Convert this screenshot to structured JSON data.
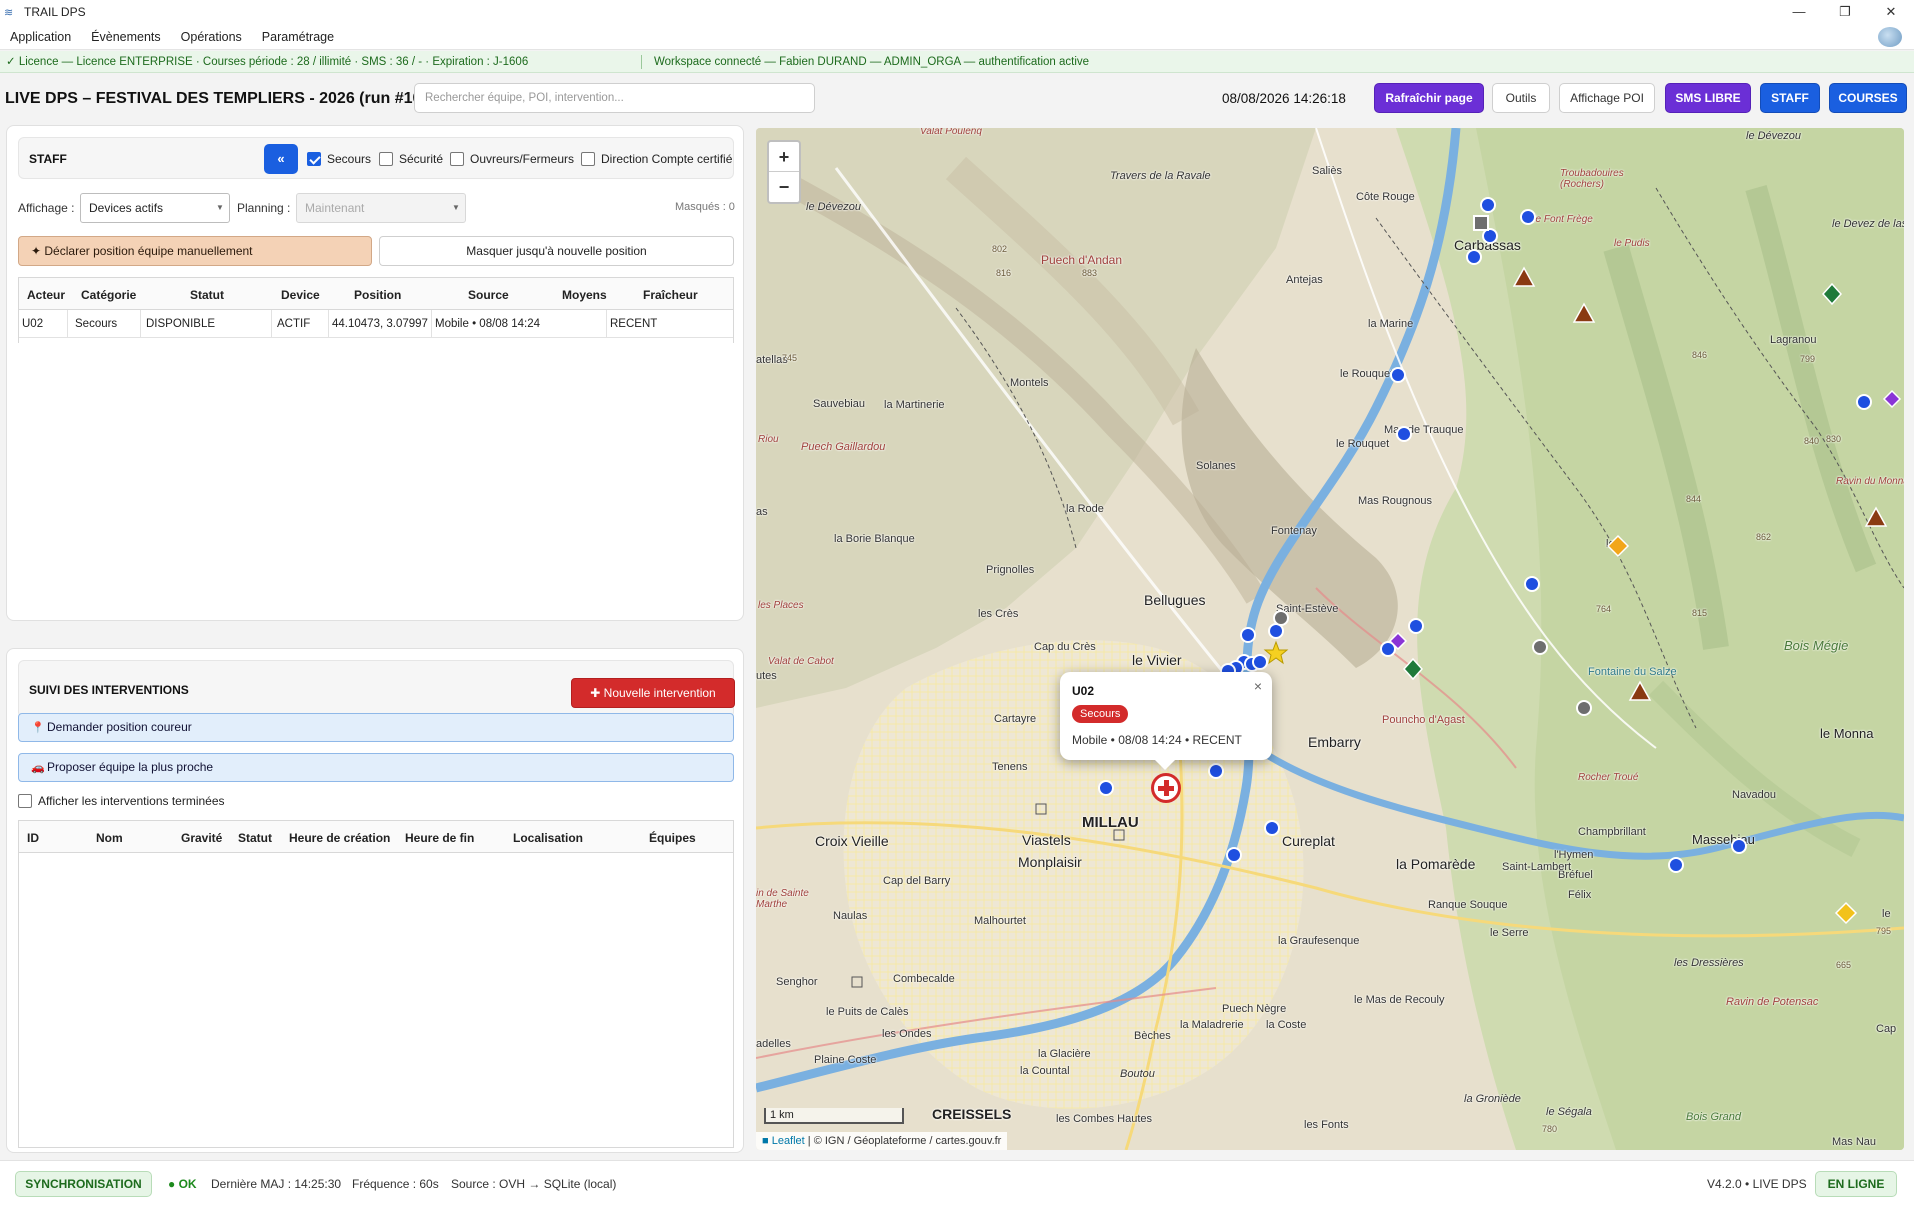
{
  "window": {
    "title": "TRAIL DPS",
    "minimize": "—",
    "maximize": "❐",
    "close": "✕"
  },
  "menu": {
    "items": [
      "Application",
      "Évènements",
      "Opérations",
      "Paramétrage"
    ]
  },
  "licence": {
    "left": "✓ Licence — Licence ENTERPRISE · Courses période : 28 / illimité · SMS : 36 / - · Expiration : J-1606",
    "right": "Workspace connecté — Fabien DURAND — ADMIN_ORGA — authentification active"
  },
  "header": {
    "title": "LIVE DPS – FESTIVAL DES TEMPLIERS - 2026 (run #10)",
    "search_placeholder": "Rechercher équipe, POI, intervention...",
    "datetime": "08/08/2026  14:26:18",
    "buttons": {
      "refresh": "Rafraîchir page",
      "tools": "Outils",
      "poi": "Affichage POI",
      "sms": "SMS LIBRE",
      "staff": "STAFF",
      "courses": "COURSES"
    }
  },
  "staff": {
    "title": "STAFF",
    "collapse": "«",
    "filters": [
      {
        "label": "Secours",
        "checked": true
      },
      {
        "label": "Sécurité",
        "checked": false
      },
      {
        "label": "Ouvreurs/Fermeurs",
        "checked": false
      },
      {
        "label": "Direction Compte certifié",
        "checked": false
      }
    ],
    "affichage_label": "Affichage :",
    "affichage_value": "Devices actifs",
    "planning_label": "Planning :",
    "planning_value": "Maintenant",
    "masked": "Masqués : 0",
    "declare_btn": "Déclarer position équipe manuellement",
    "hide_btn": "Masquer jusqu'à nouvelle position",
    "columns": [
      "Acteur",
      "Catégorie",
      "Statut",
      "Device",
      "Position",
      "Source",
      "Moyens",
      "Fraîcheur"
    ],
    "rows": [
      {
        "acteur": "U02",
        "categorie": "Secours",
        "statut": "DISPONIBLE",
        "device": "ACTIF",
        "position": "44.10473, 3.07997",
        "source": "Mobile • 08/08 14:24",
        "moyens": "",
        "fraicheur": "RECENT"
      }
    ]
  },
  "interventions": {
    "title": "SUIVI DES INTERVENTIONS",
    "new_btn": "Nouvelle intervention",
    "request_btn": "Demander position coureur",
    "propose_btn": "Proposer équipe la plus proche",
    "show_done": "Afficher les interventions terminées",
    "columns": [
      "ID",
      "Nom",
      "Gravité",
      "Statut",
      "Heure de création",
      "Heure de fin",
      "Localisation",
      "Équipes"
    ]
  },
  "map": {
    "zoom_in": "+",
    "zoom_out": "−",
    "scale": "1 km",
    "attribution_leaflet": "Leaflet",
    "attribution_rest": " | © IGN / Géoplateforme / cartes.gouv.fr",
    "popup": {
      "title": "U02",
      "badge": "Secours",
      "line": "Mobile • 08/08 14:24 • RECENT",
      "close": "×"
    },
    "places": {
      "millau": "MILLAU",
      "creissels": "CREISSELS",
      "bellugues": "Bellugues",
      "embarry": "Embarry",
      "cureplat": "Cureplat",
      "la_pomarede": "la Pomarède",
      "croix_vieille": "Croix Vieille",
      "viastels": "Viastels",
      "monplaisir": "Monplaisir",
      "le_vivier": "le Vivier",
      "carbassas": "Carbassas",
      "montels": "Montels",
      "solanes": "Solanes",
      "fontenay": "Fontenay",
      "la_rode": "la Rode",
      "prignolles": "Prignolles",
      "les_cres": "les Crès",
      "cap_du_cres": "Cap du Crès",
      "cartayre": "Cartayre",
      "tenens": "Tenens",
      "cap_del_barry": "Cap del Barry",
      "naulas": "Naulas",
      "malhourtet": "Malhourtet",
      "combecalde": "Combecalde",
      "senghor": "Senghor",
      "le_puits_de_cales": "le Puits de Calès",
      "les_ondes": "les Ondes",
      "plaine_coste": "Plaine Coste",
      "la_glaciere": "la Glacière",
      "la_countal": "la Countal",
      "beches": "Bèches",
      "puech_negre": "Puech Nègre",
      "la_maladrerie": "la Maladrerie",
      "la_coste": "la Coste",
      "la_graufesenque": "la Graufesenque",
      "ranque_souque": "Ranque Souque",
      "le_serre": "le Serre",
      "felix": "Félix",
      "brefuel": "Bréfuel",
      "l_hymen": "l'Hymen",
      "champbrillant": "Champbrillant",
      "massebiau": "Massebiau",
      "saint_lambert": "Saint-Lambert",
      "navadou": "Navadou",
      "le_monna": "le Monna",
      "saint_esteve": "Saint-Estève",
      "mas_rougnous": "Mas Rougnous",
      "le_rouquet": "le Rouquet",
      "le_rouquet2": "le Rouquet",
      "mas_de_trauque": "Mas de Trauque",
      "la_marine": "la Marine",
      "antejas": "Antejas",
      "salles": "Saliès",
      "cote_rouge": "Côte Rouge",
      "lagrandou": "Lagranou",
      "la_martinerie": "la Martinerie",
      "sauvebiau": "Sauvebiau",
      "la_borie_blanque": "la Borie Blanque",
      "travers_de_la_ravale": "Travers de la Ravale",
      "le_devezou": "le Dévezou",
      "le_devezou2": "le Dévezou",
      "puech_dandan": "Puech d'Andan",
      "puech_gaillardou": "Puech Gaillardou",
      "poncho_dagast": "Pouncho d'Agast",
      "fontaine_du_salze": "Fontaine du Salze",
      "bois_megie": "Bois Mégie",
      "le_mas_de_recouly": "le Mas de Recouly",
      "la_groniede": "la Groniède",
      "le_segala": "le Ségala",
      "bois_grand": "Bois Grand",
      "les_combes_hautes": "les Combes Hautes",
      "les_fonts": "les Fonts",
      "boutou": "Boutou",
      "les_dressieres": "les Dressières",
      "ravin_de_potensac": "Ravin de Potensac",
      "mas_nau": "Mas Nau",
      "le_devez_de_las": "le Devez de las",
      "rocher_troue": "Rocher Troué",
      "troubadouires": "Troubadouires (Rochers)",
      "fontaine_frege": "de Font Frège",
      "le_pudis": "le Pudis",
      "ravin_monna": "Ravin du Monna",
      "valat_poulenq": "Valat Poulenq",
      "riou": "Riou",
      "les_places": "les Places",
      "valat_de_cabot": "Valat de Cabot",
      "utes": "utes",
      "atellas": "atellas",
      "as": "as",
      "cap": "Cap",
      "adelles": "adelles",
      "in_de_sainte_marthe": "in de Sainte Marthe",
      "e_left": "le",
      "e_right": "le"
    },
    "spot_heights": [
      "816",
      "883",
      "802",
      "840",
      "830",
      "846",
      "844",
      "862",
      "799",
      "745",
      "815",
      "764",
      "780",
      "665",
      "795"
    ]
  },
  "footer": {
    "sync": "SYNCHRONISATION",
    "ok": "● OK",
    "last": "Dernière MAJ : 14:25:30",
    "freq": "Fréquence : 60s",
    "source": "Source : OVH → SQLite (local)",
    "version": "V4.2.0 • LIVE DPS",
    "online": "EN LIGNE"
  },
  "colors": {
    "accent_blue": "#1a5fe0",
    "accent_purple": "#6b2fd6",
    "alert_red": "#d32b2b",
    "marker_blue": "#1f4fe0",
    "ok_green": "#1d6b1d"
  },
  "icons": {
    "app": "trail-logo-icon",
    "declare": "pin-icon",
    "request": "pushpin-icon",
    "propose": "car-icon",
    "new": "plus-icon"
  }
}
